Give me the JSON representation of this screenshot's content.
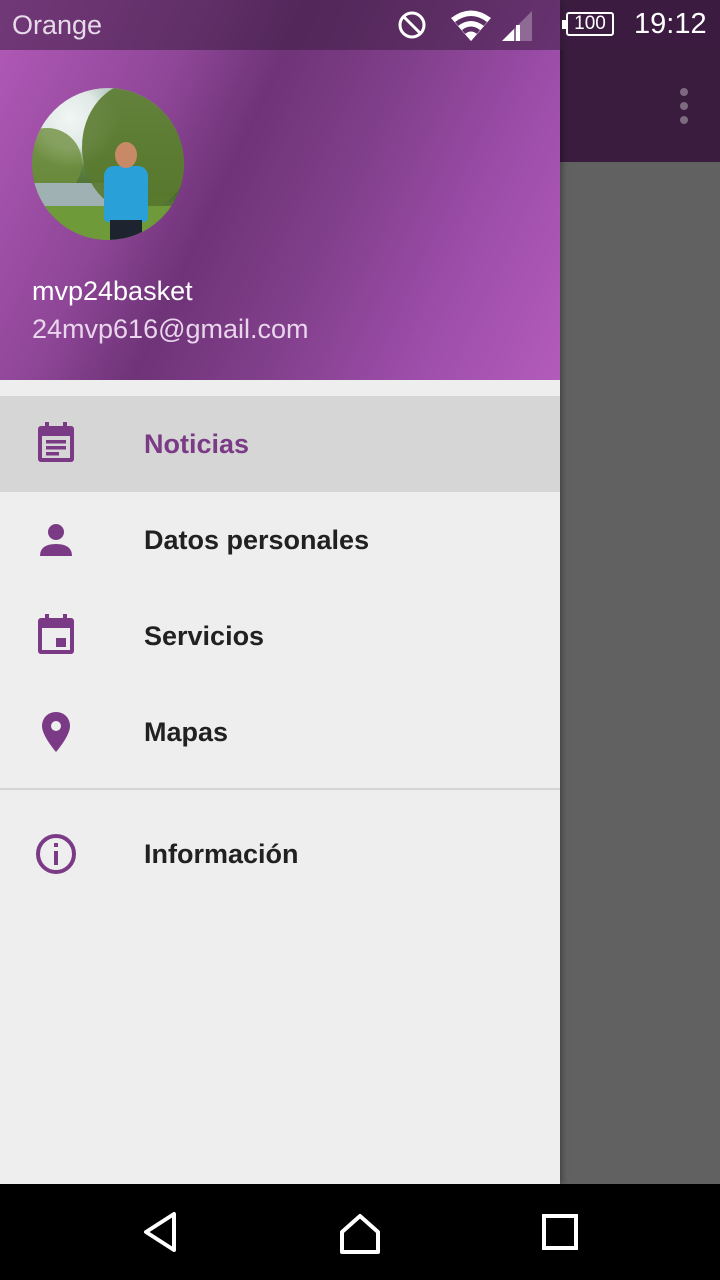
{
  "status_bar": {
    "carrier": "Orange",
    "battery_level": "100",
    "time": "19:12",
    "icons": [
      "do-not-disturb-icon",
      "wifi-icon",
      "cell-signal-icon",
      "battery-icon"
    ]
  },
  "drawer": {
    "header": {
      "username": "mvp24basket",
      "email": "24mvp616@gmail.com"
    },
    "items": [
      {
        "label": "Noticias",
        "icon": "news-icon",
        "active": true
      },
      {
        "label": "Datos personales",
        "icon": "person-icon",
        "active": false
      },
      {
        "label": "Servicios",
        "icon": "calendar-icon",
        "active": false
      },
      {
        "label": "Mapas",
        "icon": "map-pin-icon",
        "active": false
      }
    ],
    "secondary_items": [
      {
        "label": "Información",
        "icon": "info-icon",
        "active": false
      }
    ]
  },
  "colors": {
    "accent": "#7b3a86",
    "header_gradient_start": "#b35ab9",
    "header_gradient_dark": "#6f3378",
    "drawer_bg": "#eeeeee",
    "active_row_bg": "#d6d6d6",
    "scrim": "#616161"
  },
  "nav_bar": {
    "icons": [
      "back-icon",
      "home-icon",
      "recents-icon"
    ]
  }
}
